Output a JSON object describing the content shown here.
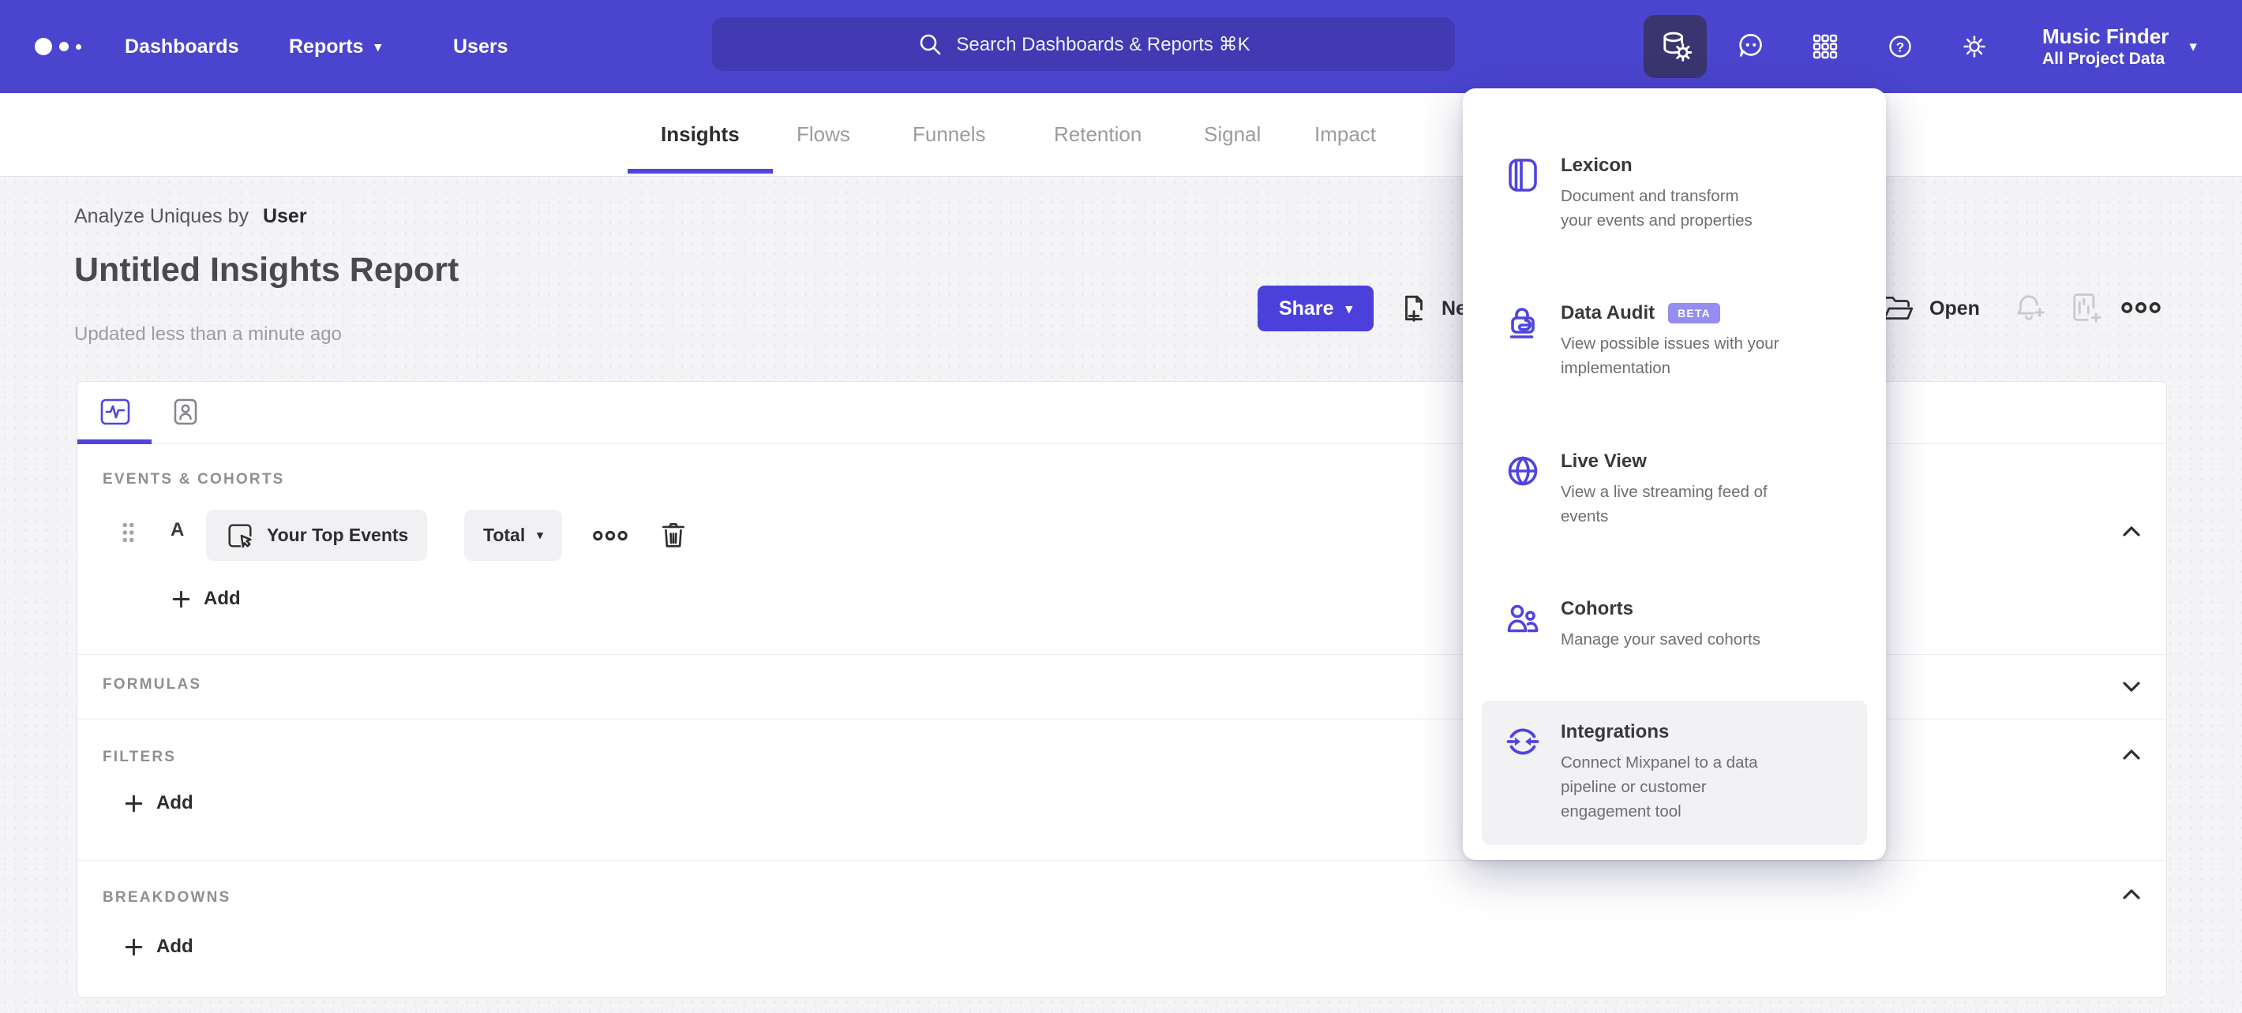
{
  "colors": {
    "accent": "#4f44e0",
    "nav_bg": "#4b44ce",
    "nav_active_bg": "#3a356f",
    "page_bg": "#f4f4f6",
    "badge_bg": "#968df0"
  },
  "nav": {
    "links": [
      {
        "label": "Dashboards"
      },
      {
        "label": "Reports"
      },
      {
        "label": "Users"
      }
    ],
    "search_placeholder": "Search Dashboards & Reports ⌘K",
    "project_name": "Music Finder",
    "project_subtitle": "All Project Data"
  },
  "tabs": {
    "items": [
      {
        "label": "Insights",
        "active": true
      },
      {
        "label": "Flows"
      },
      {
        "label": "Funnels"
      },
      {
        "label": "Retention"
      },
      {
        "label": "Signal"
      },
      {
        "label": "Impact"
      }
    ]
  },
  "header": {
    "analyze_prefix": "Analyze Uniques by",
    "analyze_entity": "User",
    "title": "Untitled Insights Report",
    "updated": "Updated less than a minute ago",
    "share_label": "Share",
    "new_label": "New",
    "open_label": "Open"
  },
  "builder": {
    "events_label": "EVENTS & COHORTS",
    "row": {
      "letter": "A",
      "event_name": "Your Top Events",
      "metric": "Total"
    },
    "events_add_label": "Add",
    "formulas_label": "FORMULAS",
    "filters_label": "FILTERS",
    "filters_add_label": "Add",
    "breakdowns_label": "BREAKDOWNS",
    "breakdowns_add_label": "Add"
  },
  "menu": {
    "items": [
      {
        "title": "Lexicon",
        "description": "Document and transform your events and properties"
      },
      {
        "title": "Data Audit",
        "badge": "BETA",
        "description": "View possible issues with your implementation"
      },
      {
        "title": "Live View",
        "description": "View a live streaming feed of events"
      },
      {
        "title": "Cohorts",
        "description": "Manage your saved cohorts"
      },
      {
        "title": "Integrations",
        "description": "Connect Mixpanel to a data pipeline or customer engagement tool"
      }
    ]
  }
}
